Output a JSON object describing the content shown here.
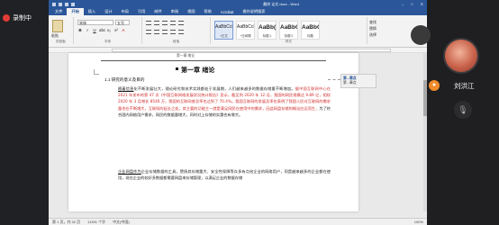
{
  "recorder": {
    "label": "录制中"
  },
  "word": {
    "title": "最终 论文.docx",
    "app": "Word",
    "tabs": [
      "文件",
      "开始",
      "插入",
      "设计",
      "布局",
      "引用",
      "邮件",
      "审阅",
      "视图",
      "帮助",
      "Acrobat",
      "操作说明搜索"
    ],
    "active_tab": "开始",
    "ribbon": {
      "paste_label": "粘贴",
      "font_name": "宋体",
      "font_size": "五号",
      "format_buttons": [
        "B",
        "I",
        "U",
        "abc",
        "x₂",
        "x²",
        "A"
      ],
      "styles": [
        {
          "sample": "AaBbCcDc",
          "name": "+正文"
        },
        {
          "sample": "AaBbCcDc",
          "name": "+无间隔"
        },
        {
          "sample": "AaBb(",
          "name": "标题 1"
        },
        {
          "sample": "AaBbC",
          "name": "标题 2"
        },
        {
          "sample": "AaBbC",
          "name": "标题"
        }
      ],
      "find": [
        "查找",
        "替换",
        "选择"
      ],
      "group_labels": [
        "剪贴板",
        "字体",
        "段落",
        "样式",
        "编辑"
      ]
    },
    "document": {
      "header_text": "第一章    绪论",
      "chapter_title": "第一章    绪论",
      "section": "1.1    研究的意义及目的",
      "para1_lead": "随着信息",
      "para1_a": "化不断发展壮大，理论研究和技术实践都处于发展期，人们越来越多的数据存储量不断增加。",
      "para1_red": "据中国互联网中心在 2021 年发布的第 47 次《中国互联网络发展状况统计报告》显示，截至到 2020 年 12 月，我国的网民规模达 9.89 亿，相较 2020 年 3 月增长 8540 万，我国的互联网普及率也达到了 70.4%。我国互联网的发展及率也表明了我国人民对互联网的需求量也在不断增大，互联网的延长之处，其主要的功能主一就是满足网民在使用中的需求，因此网盘存储的概念应运而生，",
      "para1_b": "为了符合国内网络用户需求，网民的数据量增大，同时对上存储的实惠也有增大。",
      "para2_lead": "企业网盘作为",
      "para2": "企业存储数据的工具，赞扬其存储量大、安全性保障等众多有点给企业的网络用户，同是越来越多的企业都在使用，现在企业的较好多数据都需要网盘来存储管理，以满足企业的数据存储",
      "comment_author": "第...章点",
      "comment_body": "第...章点"
    },
    "status": {
      "page": "第 1 页，共 32 页",
      "words": "11391 个字",
      "language": "中文(中国)",
      "zoom": "100%"
    }
  },
  "call": {
    "participant_name": "刘洪江",
    "mic_state": "muted"
  }
}
